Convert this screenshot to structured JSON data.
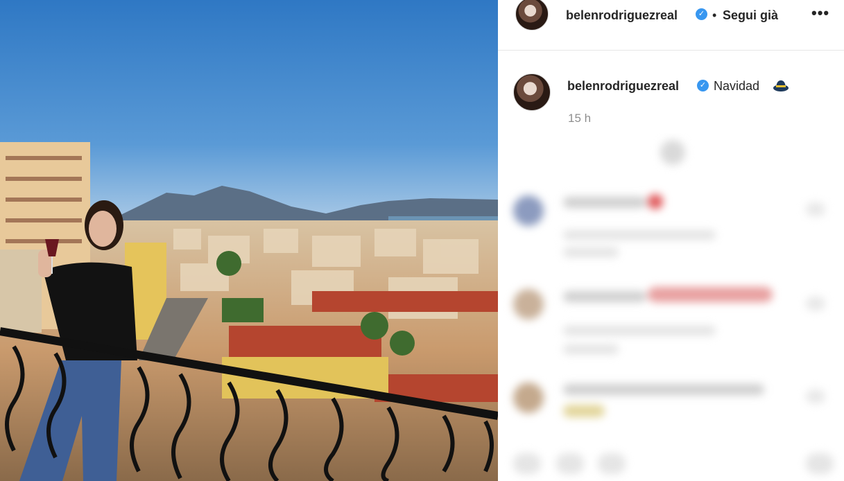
{
  "header": {
    "username": "belenrodriguezreal",
    "verified_glyph": "✓",
    "separator": "•",
    "follow_status": "Segui già",
    "more_glyph": "•••"
  },
  "caption": {
    "username": "belenrodriguezreal",
    "verified_glyph": "✓",
    "text": "Navidad",
    "emoji_icon": "hat-icon",
    "time": "15 h"
  },
  "icons": {
    "verified": "verified-badge-icon",
    "more": "more-options-icon"
  },
  "colors": {
    "verified": "#3897f0",
    "sky": "#3b7fc6",
    "text": "#262626",
    "muted": "#8e8e8e"
  }
}
